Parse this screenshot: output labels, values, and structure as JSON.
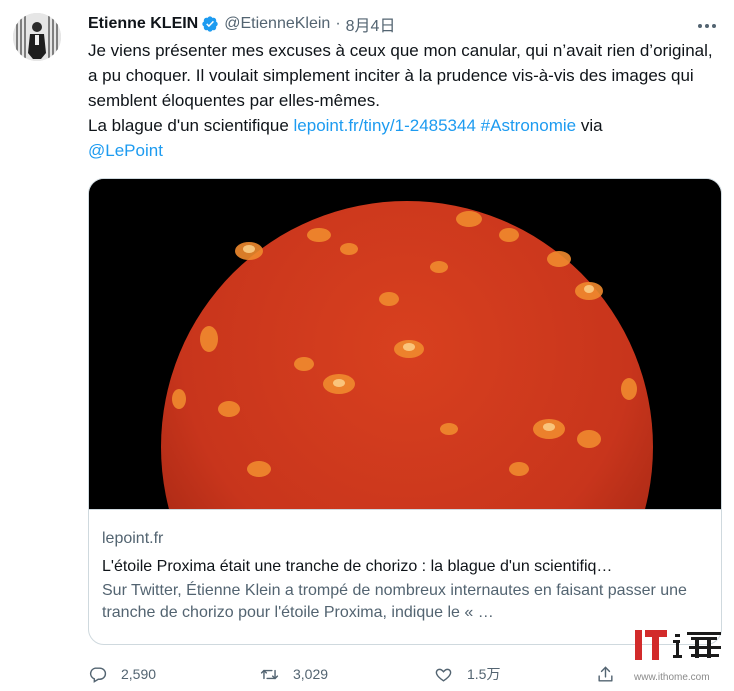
{
  "tweet": {
    "author_name": "Etienne KLEIN",
    "handle": "@EtienneKlein",
    "separator": "·",
    "date": "8月4日",
    "text_line1": "Je viens présenter mes excuses à ceux que mon canular, qui n’avait rien d’original, a pu choquer. Il voulait simplement inciter à la prudence vis-à-vis des images qui semblent éloquentes par elles-mêmes.",
    "text_prefix": "La blague d'un scientifique ",
    "link_url": "lepoint.fr/tiny/1-2485344",
    "hashtag": "#Astronomie",
    "text_via": " via",
    "mention": "@LePoint"
  },
  "card": {
    "domain": "lepoint.fr",
    "title": "L'étoile Proxima était une tranche de chorizo : la blague d'un scientifiq…",
    "description": "Sur Twitter, Étienne Klein a trompé de nombreux internautes en faisant passer une tranche de chorizo pour l'étoile Proxima, indique le « …"
  },
  "actions": {
    "replies": "2,590",
    "retweets": "3,029",
    "likes": "1.5万"
  },
  "watermark": {
    "url": "www.ithome.com"
  },
  "colors": {
    "link": "#1d9bf0",
    "secondary_text": "#536471",
    "verified": "#1d9bf0",
    "chorizo_red": "#d93a1f"
  },
  "icons": [
    "verified-badge-icon",
    "more-icon",
    "reply-icon",
    "retweet-icon",
    "like-icon",
    "share-icon",
    "ithome-logo"
  ]
}
